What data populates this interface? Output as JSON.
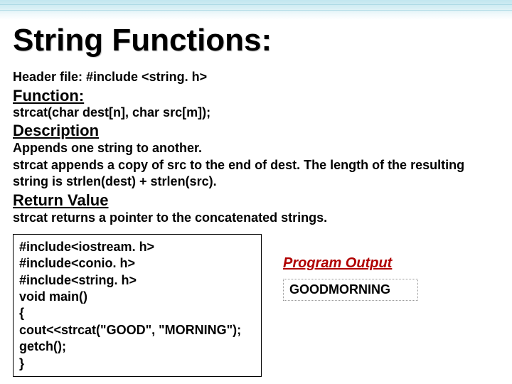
{
  "title": "String Functions:",
  "header_file": "Header file: #include <string. h>",
  "function_heading": "Function:",
  "function_signature": " strcat(char  dest[n], char  src[m]);",
  "description_heading": "Description",
  "description_line1": "Appends one string to another.",
  "description_line2": "strcat appends a copy of src to the end of dest. The length of the resulting",
  "description_line3": " string is strlen(dest) + strlen(src).",
  "return_heading": "Return Value",
  "return_text": "strcat returns a pointer to the concatenated strings.",
  "code": {
    "l1": "#include<iostream. h>",
    "l2": "#include<conio. h>",
    "l3": "#include<string. h>",
    "l4": " ",
    "l5": "void main()",
    "l6": " {",
    "l7": "  cout<<strcat(\"GOOD\", \"MORNING\");",
    "l8": "  getch();",
    "l9": " }"
  },
  "output_label": "Program Output",
  "output_value": "GOODMORNING"
}
